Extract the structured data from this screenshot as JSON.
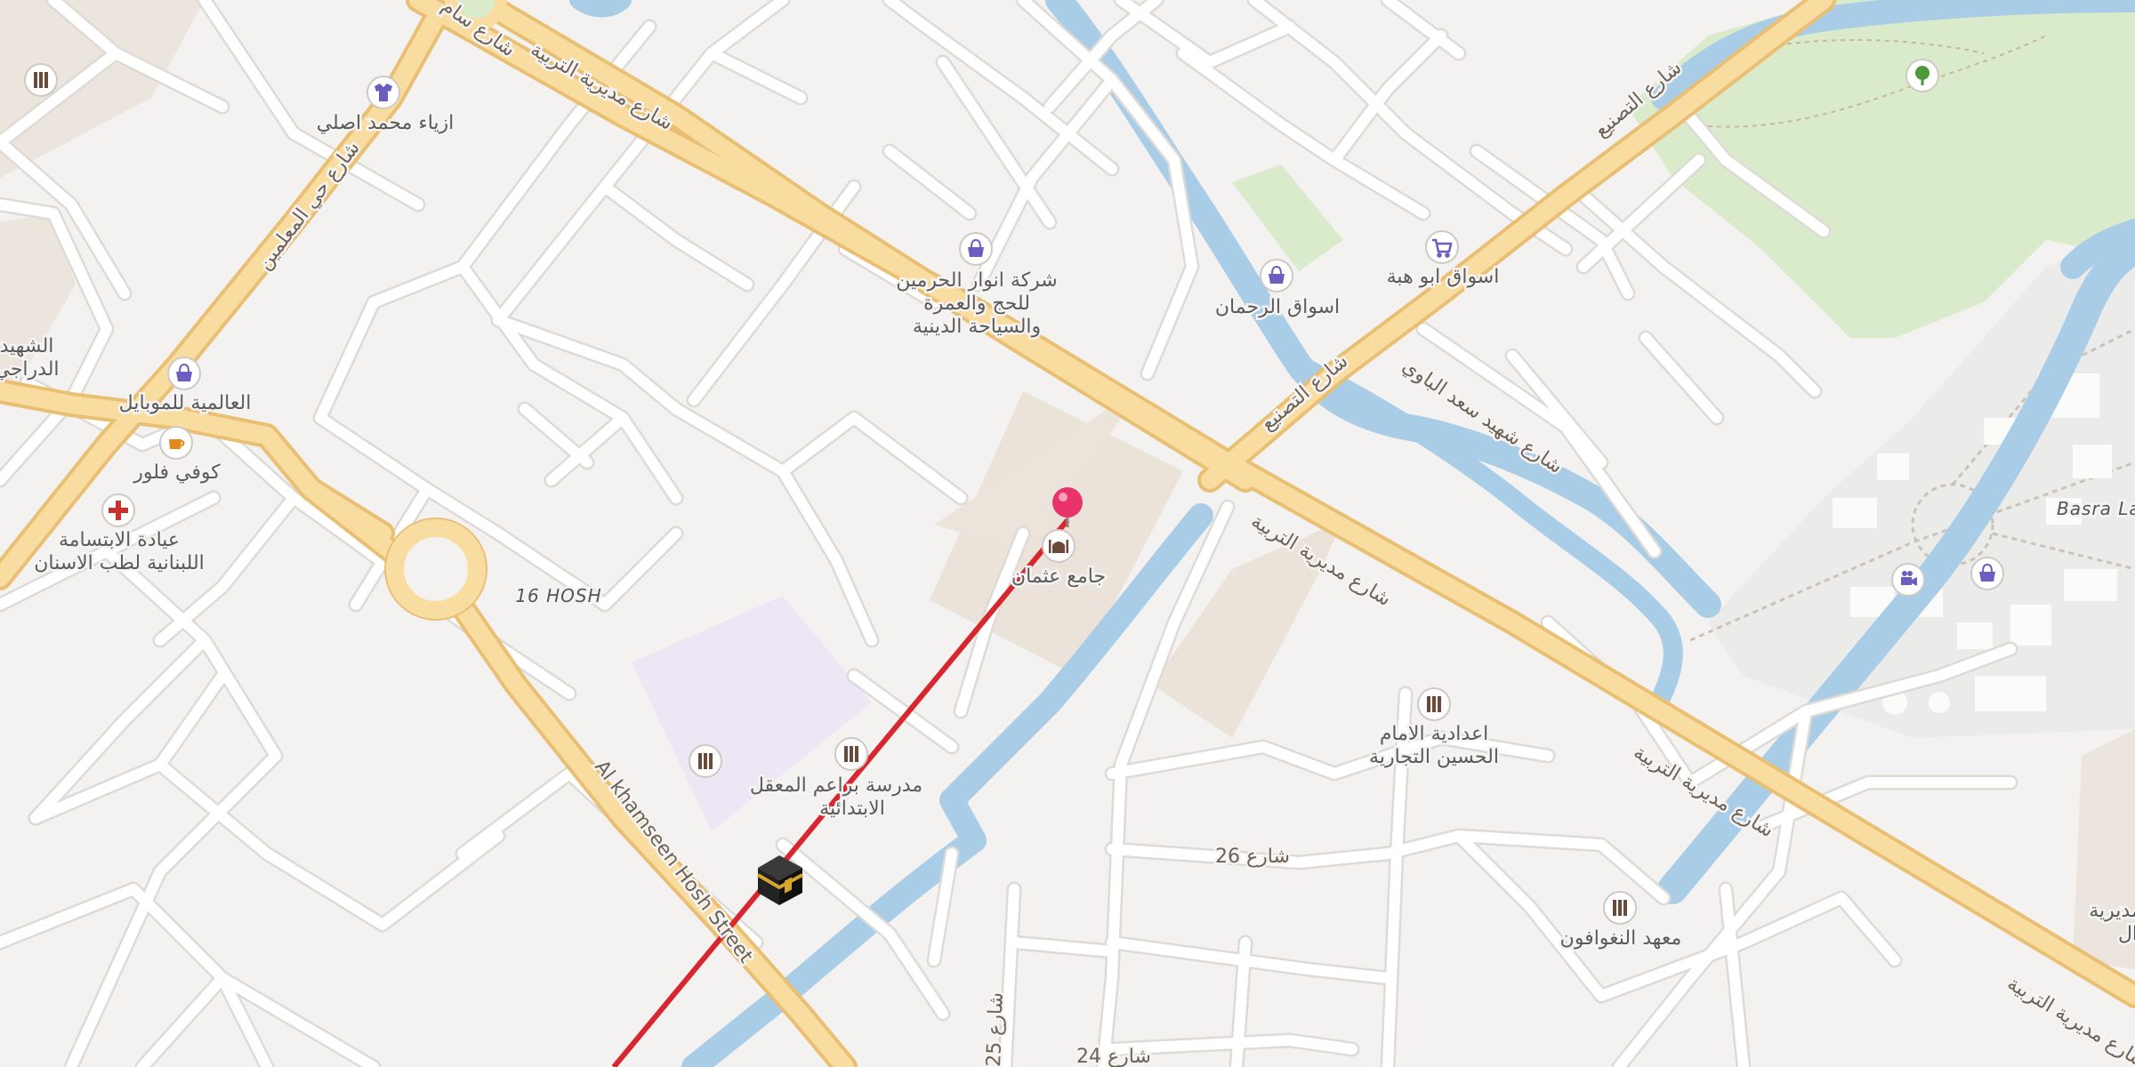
{
  "map": {
    "colors": {
      "background": "#f4f2f0",
      "water": "#a9cde6",
      "park": "#d9ebcb",
      "major_road": "#f9dda0",
      "major_road_casing": "#e9bf74",
      "minor_road": "#ffffff",
      "building_block": "#ebe2da",
      "school_zone": "#ece6f5",
      "route_line": "#d8262e",
      "pin": "#e8336b"
    },
    "area_labels": {
      "hosh16": "16 HOSH",
      "basra": "Basra La"
    },
    "street_labels": {
      "tarbiya_nw": "شارع مديرية التربية",
      "tarbiya_mid": "شارع مديرية التربية",
      "tarbiya_se": "شارع مديرية التربية",
      "tarbiya_far": "شارع مديرية التربية",
      "taseer_upper": "شارع التصنيع",
      "taseer_lower": "شارع التصنيع",
      "shaheed_saad": "شارع شهيد سعد الباوي",
      "mawaddi": "شارع حي المعلمين",
      "khamseen": "Al khamseen Hosh Street",
      "st26": "شارع 26",
      "st24": "شارع 24",
      "st25": "شارع 25",
      "top_partial": "شارع سام"
    },
    "pois": [
      {
        "id": "library_top_left",
        "icon": "school-icon",
        "label": ""
      },
      {
        "id": "clothes",
        "icon": "clothes-icon",
        "label": "ازياء محمد اصلي"
      },
      {
        "id": "anwar",
        "icon": "shop-icon",
        "label_lines": [
          "شركة انوار الحرمين",
          "للحج والعمرة",
          "والسياحة الدينية"
        ]
      },
      {
        "id": "aswaq_rahman",
        "icon": "shop-icon",
        "label": "اسواق الرحمان"
      },
      {
        "id": "aswaq_abu",
        "icon": "cart-icon",
        "label": "اسواق ابو هبة"
      },
      {
        "id": "tree",
        "icon": "tree-icon",
        "label": ""
      },
      {
        "id": "mobile",
        "icon": "shop-icon",
        "label": "العالمية للموبايل"
      },
      {
        "id": "cafe",
        "icon": "cafe-icon",
        "label": "كوفي فلور"
      },
      {
        "id": "dental",
        "icon": "hospital-icon",
        "label_lines": [
          "عيادة الابتسامة",
          "اللبنانية لطب الاسنان"
        ]
      },
      {
        "id": "shaheed_left",
        "icon": "",
        "label_lines": [
          "الشهيد",
          "الدراجي"
        ]
      },
      {
        "id": "mosque",
        "icon": "mosque-icon",
        "label": "جامع عثمان"
      },
      {
        "id": "school1",
        "icon": "school-icon",
        "label": ""
      },
      {
        "id": "school2",
        "icon": "school-icon",
        "label_lines": [
          "مدرسة براعم المعقل",
          "الابتدائية"
        ]
      },
      {
        "id": "imam",
        "icon": "school-icon",
        "label_lines": [
          "اعدادية الامام",
          "الحسين التجارية"
        ]
      },
      {
        "id": "institute",
        "icon": "school-icon",
        "label": "معهد النغوافون"
      },
      {
        "id": "cinema",
        "icon": "cinema-icon",
        "label": ""
      },
      {
        "id": "shop_right",
        "icon": "shop-icon",
        "label": ""
      },
      {
        "id": "far_right",
        "icon": "",
        "label_lines": [
          "مديرية",
          "ال"
        ]
      }
    ],
    "markers": {
      "pin": {
        "name": "selected-location"
      },
      "kaaba": {
        "name": "qibla-direction"
      }
    }
  }
}
